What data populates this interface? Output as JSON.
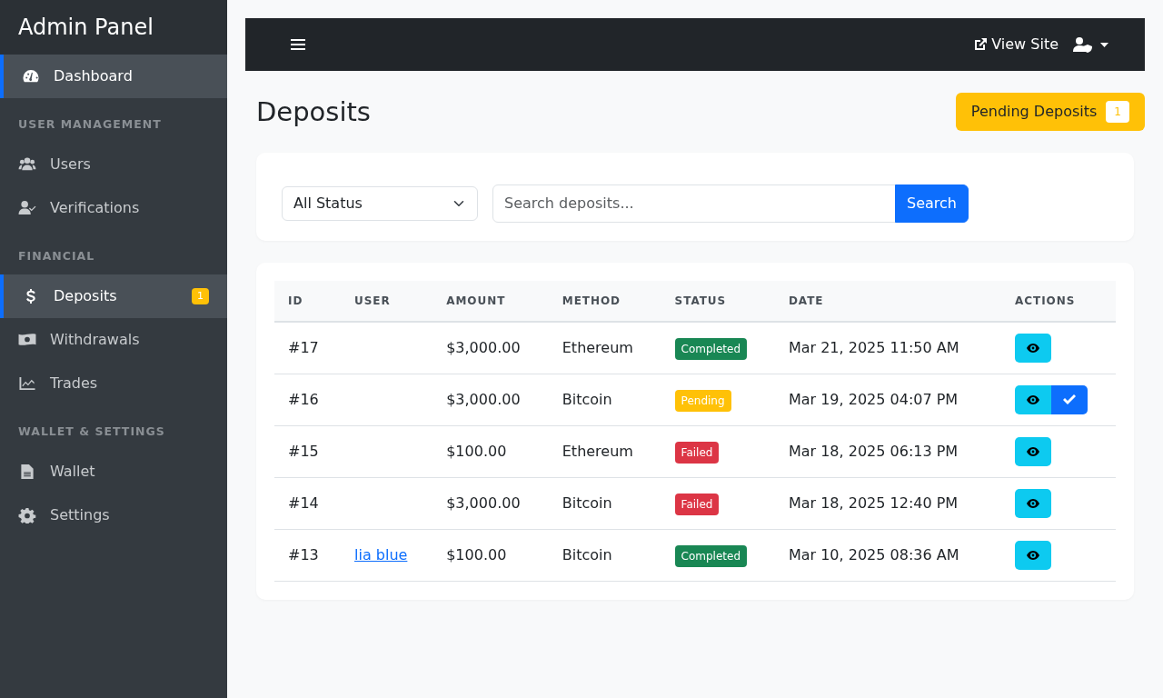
{
  "sidebar": {
    "title": "Admin Panel",
    "sections": [
      {
        "items": [
          {
            "label": "Dashboard",
            "selected": true
          }
        ]
      },
      {
        "heading": "USER MANAGEMENT",
        "items": [
          {
            "label": "Users",
            "selected": false
          },
          {
            "label": "Verifications",
            "selected": false
          }
        ]
      },
      {
        "heading": "FINANCIAL",
        "items": [
          {
            "label": "Deposits",
            "selected": true,
            "badge": "1"
          },
          {
            "label": "Withdrawals",
            "selected": false
          },
          {
            "label": "Trades",
            "selected": false
          }
        ]
      },
      {
        "heading": "WALLET & SETTINGS",
        "items": [
          {
            "label": "Wallet",
            "selected": false
          },
          {
            "label": "Settings",
            "selected": false
          }
        ]
      }
    ]
  },
  "topbar": {
    "view_site": "View Site"
  },
  "page": {
    "title": "Deposits",
    "pending_button": {
      "label": "Pending Deposits",
      "count": "1"
    }
  },
  "filters": {
    "status": "All Status",
    "search_placeholder": "Search deposits...",
    "search_button": "Search"
  },
  "table": {
    "columns": [
      "ID",
      "USER",
      "AMOUNT",
      "METHOD",
      "STATUS",
      "DATE",
      "ACTIONS"
    ],
    "rows": [
      {
        "id": "#17",
        "amount": "$3,000.00",
        "method": "Ethereum",
        "status": {
          "label": "Completed",
          "kind": "completed"
        },
        "date": "Mar 21, 2025 11:50 AM",
        "actions": [
          {
            "kind": "view"
          }
        ]
      },
      {
        "id": "#16",
        "amount": "$3,000.00",
        "method": "Bitcoin",
        "status": {
          "label": "Pending",
          "kind": "pending"
        },
        "date": "Mar 19, 2025 04:07 PM",
        "actions": [
          {
            "kind": "view"
          },
          {
            "kind": "approve"
          }
        ]
      },
      {
        "id": "#15",
        "amount": "$100.00",
        "method": "Ethereum",
        "status": {
          "label": "Failed",
          "kind": "failed"
        },
        "date": "Mar 18, 2025 06:13 PM",
        "actions": [
          {
            "kind": "view"
          }
        ]
      },
      {
        "id": "#14",
        "amount": "$3,000.00",
        "method": "Bitcoin",
        "status": {
          "label": "Failed",
          "kind": "failed"
        },
        "date": "Mar 18, 2025 12:40 PM",
        "actions": [
          {
            "kind": "view"
          }
        ]
      },
      {
        "id": "#13",
        "user": "lia blue",
        "amount": "$100.00",
        "method": "Bitcoin",
        "status": {
          "label": "Completed",
          "kind": "completed"
        },
        "date": "Mar 10, 2025 08:36 AM",
        "actions": [
          {
            "kind": "view"
          }
        ]
      }
    ]
  }
}
